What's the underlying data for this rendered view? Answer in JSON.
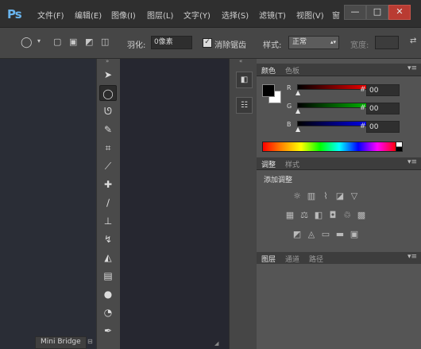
{
  "app": {
    "logo": "Ps"
  },
  "menu": [
    "文件(F)",
    "编辑(E)",
    "图像(I)",
    "图层(L)",
    "文字(Y)",
    "选择(S)",
    "滤镜(T)",
    "视图(V)",
    "窗"
  ],
  "window_controls": {
    "minimize": "—",
    "maximize": "□",
    "close": "✕"
  },
  "options_bar": {
    "feather_label": "羽化:",
    "feather_value": "0像素",
    "antialias_label": "消除锯齿",
    "antialias_checked": true,
    "style_label": "样式:",
    "style_value": "正常",
    "width_label": "宽度:"
  },
  "tools": [
    "move-icon",
    "marquee-icon",
    "lasso-icon",
    "quick-select-icon",
    "crop-icon",
    "eyedropper-icon",
    "healing-brush-icon",
    "brush-icon",
    "clone-stamp-icon",
    "history-brush-icon",
    "eraser-icon",
    "gradient-icon",
    "blur-icon",
    "dodge-icon",
    "pen-icon"
  ],
  "color_panel": {
    "tabs": [
      "颜色",
      "色板"
    ],
    "channels": [
      {
        "name": "R",
        "value": "00",
        "color": "#ff0000"
      },
      {
        "name": "G",
        "value": "00",
        "color": "#00c000"
      },
      {
        "name": "B",
        "value": "00",
        "color": "#0000ff"
      }
    ],
    "foreground": "#000000",
    "background": "#ffffff"
  },
  "adjust_panel": {
    "tabs": [
      "调整",
      "样式"
    ],
    "title": "添加调整"
  },
  "layers_panel": {
    "tabs": [
      "图层",
      "通道",
      "路径"
    ]
  },
  "mini_bridge": {
    "label": "Mini Bridge"
  }
}
